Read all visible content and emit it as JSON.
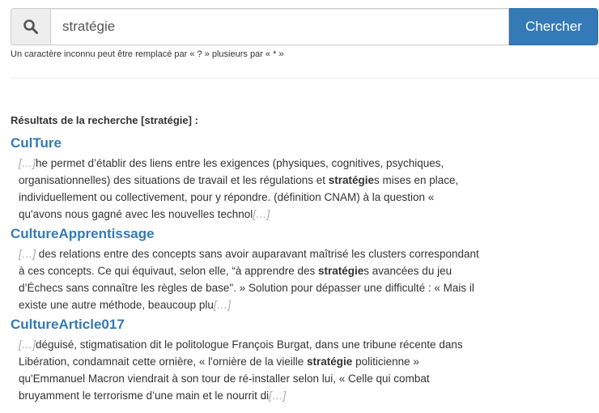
{
  "search": {
    "value": "stratégie",
    "button_label": "Chercher",
    "hint": "Un caractère inconnu peut être remplacé par « ? » plusieurs par « * »"
  },
  "results": {
    "heading": "Résultats de la recherche [stratégie] :",
    "ellipsis": "[…]",
    "items": [
      {
        "title": "CulTure",
        "before": "he permet d’établir des liens entre les exigences (physiques, cognitives, psychiques, organisationnelles) des situations de travail et les régulations et ",
        "match": "stratégie",
        "after": "s mises en place, individuellement ou collectivement, pour y répondre. (définition CNAM) à la question « qu'avons nous gagné avec les nouvelles technol"
      },
      {
        "title": "CultureApprentissage",
        "before": " des relations entre des concepts sans avoir auparavant maîtrisé les clusters correspondant à ces concepts. Ce qui équivaut, selon elle, “à apprendre des ",
        "match": "stratégie",
        "after": "s avancées du jeu d’Échecs sans connaître les règles de base\". » Solution pour dépasser une difficulté : « Mais il existe une autre méthode, beaucoup plu"
      },
      {
        "title": "CultureArticle017",
        "before": "déguisé, stigmatisation dit le politologue François Burgat, dans une tribune récente dans Libération, condamnait cette ornière, « l'ornière de la vieille ",
        "match": "stratégie",
        "after": " politicienne » qu'Emmanuel Macron viendrait à son tour de ré-installer selon lui, « Celle qui combat bruyamment le terrorisme d’une main et le nourrit di"
      }
    ]
  }
}
